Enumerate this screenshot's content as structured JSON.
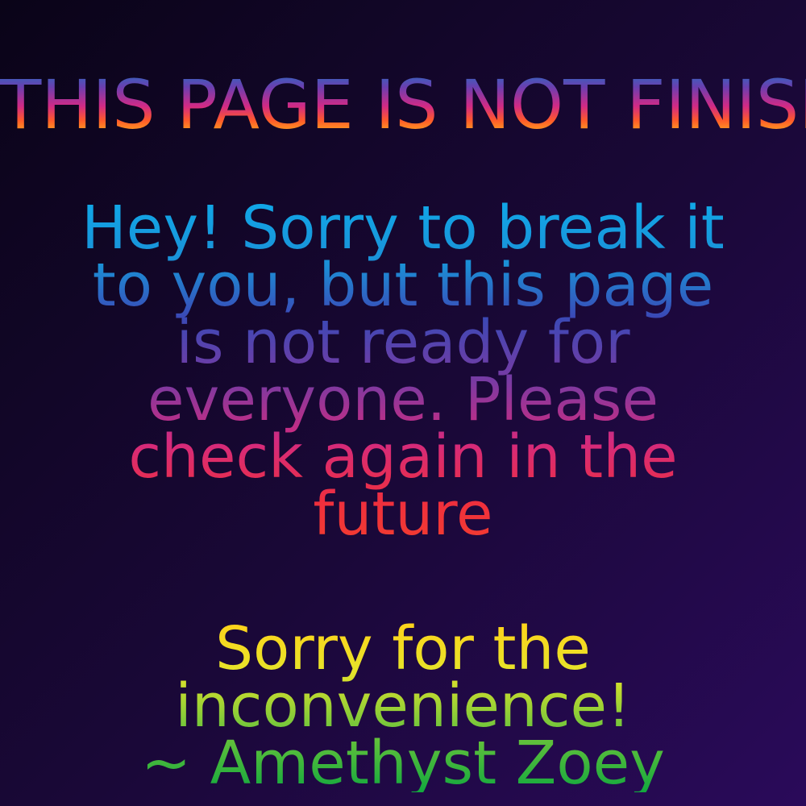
{
  "heading": {
    "lines": [
      "THIS PAGE IS NOT",
      "FINISHED!!!"
    ]
  },
  "message": {
    "lines": [
      "Hey! Sorry to break it",
      "to you, but this page",
      "is not ready for",
      "everyone. Please",
      "check again in the",
      "future"
    ]
  },
  "signoff": {
    "lines": [
      "Sorry for the",
      "inconvenience!",
      "~ Amethyst Zoey"
    ]
  },
  "colors": {
    "background_dark": "#0a0418",
    "background_purple": "#2a0a5a",
    "blue": "#10a8e8",
    "purple": "#7a3aa2",
    "pink": "#d42a7e",
    "red": "#ef2f3d",
    "yellow": "#ffd21a",
    "green": "#12a83e"
  }
}
